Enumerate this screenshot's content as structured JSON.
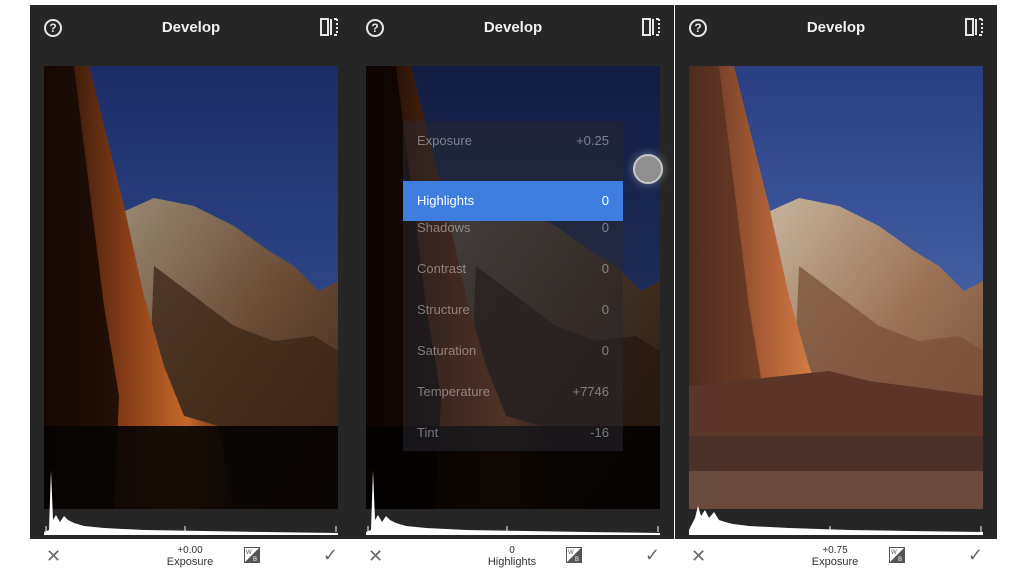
{
  "panels": [
    {
      "title": "Develop",
      "bottom": {
        "value": "+0.00",
        "label": "Exposure"
      }
    },
    {
      "title": "Develop",
      "bottom": {
        "value": "0",
        "label": "Highlights"
      },
      "menu": [
        {
          "label": "Exposure",
          "value": "+0.25"
        },
        {
          "label": "Highlights",
          "value": "0",
          "active": true
        },
        {
          "label": "Shadows",
          "value": "0"
        },
        {
          "label": "Contrast",
          "value": "0"
        },
        {
          "label": "Structure",
          "value": "0"
        },
        {
          "label": "Saturation",
          "value": "0"
        },
        {
          "label": "Temperature",
          "value": "+7746"
        },
        {
          "label": "Tint",
          "value": "-16"
        }
      ]
    },
    {
      "title": "Develop",
      "bottom": {
        "value": "+0.75",
        "label": "Exposure"
      }
    }
  ],
  "icons": {
    "help": "question-circle-icon",
    "compare": "compare-split-icon",
    "cancel": "close-icon",
    "apply": "check-icon",
    "white_balance": "white-balance-icon"
  },
  "colors": {
    "background": "#262626",
    "accent": "#3d7ee0",
    "bottom_bar": "#ffffff"
  }
}
